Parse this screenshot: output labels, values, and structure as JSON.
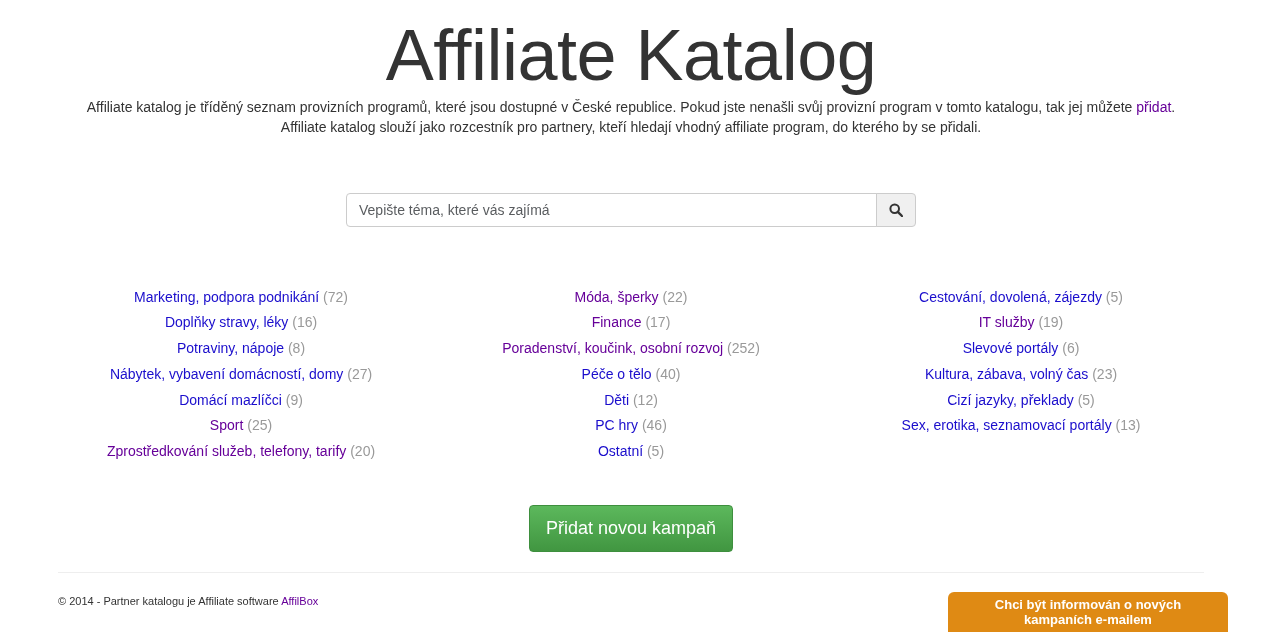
{
  "title": "Affiliate Katalog",
  "intro": {
    "line1": "Affiliate katalog je tříděný seznam provizních programů, které jsou dostupné v České republice. Pokud jste nenašli svůj provizní program v tomto katalogu, tak jej můžete ",
    "link": {
      "label": "přidat",
      "visited": true
    },
    "line1_end": ".",
    "line2": "Affiliate katalog slouží jako rozcestník pro partnery, kteří hledají vhodný affiliate program, do kterého by se přidali."
  },
  "search": {
    "placeholder": "Vepište téma, které vás zajímá"
  },
  "columns": [
    [
      {
        "label": "Marketing, podpora podnikání",
        "count": "(72)",
        "visited": false
      },
      {
        "label": "Doplňky stravy, léky",
        "count": "(16)",
        "visited": false
      },
      {
        "label": "Potraviny, nápoje",
        "count": "(8)",
        "visited": false
      },
      {
        "label": "Nábytek, vybavení domácností, domy",
        "count": "(27)",
        "visited": false
      },
      {
        "label": "Domácí mazlíčci",
        "count": "(9)",
        "visited": false
      },
      {
        "label": "Sport",
        "count": "(25)",
        "visited": true
      },
      {
        "label": "Zprostředkování služeb, telefony, tarify",
        "count": "(20)",
        "visited": true
      }
    ],
    [
      {
        "label": "Móda, šperky",
        "count": "(22)",
        "visited": true
      },
      {
        "label": "Finance",
        "count": "(17)",
        "visited": true
      },
      {
        "label": "Poradenství, koučink, osobní rozvoj",
        "count": "(252)",
        "visited": true
      },
      {
        "label": "Péče o tělo",
        "count": "(40)",
        "visited": false
      },
      {
        "label": "Děti",
        "count": "(12)",
        "visited": false
      },
      {
        "label": "PC hry",
        "count": "(46)",
        "visited": false
      },
      {
        "label": "Ostatní",
        "count": "(5)",
        "visited": false
      }
    ],
    [
      {
        "label": "Cestování, dovolená, zájezdy",
        "count": "(5)",
        "visited": false
      },
      {
        "label": "IT služby",
        "count": "(19)",
        "visited": true
      },
      {
        "label": "Slevové portály",
        "count": "(6)",
        "visited": false
      },
      {
        "label": "Kultura, zábava, volný čas",
        "count": "(23)",
        "visited": false
      },
      {
        "label": "Cizí jazyky, překlady",
        "count": "(5)",
        "visited": false
      },
      {
        "label": "Sex, erotika, seznamovací portály",
        "count": "(13)",
        "visited": false
      }
    ]
  ],
  "add_button": "Přidat novou kampaň",
  "footer": {
    "text": "© 2014 - Partner katalogu je Affiliate software ",
    "link": {
      "label": "AffilBox",
      "visited": true
    }
  },
  "notify_tab": {
    "line1": "Chci být informován o nových",
    "line2": "kampaních e-mailem"
  }
}
